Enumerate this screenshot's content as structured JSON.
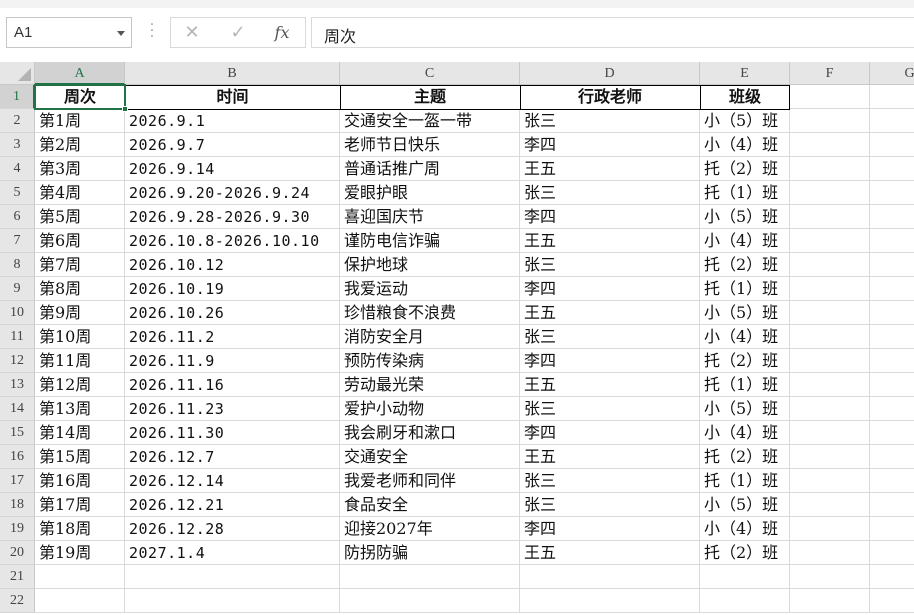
{
  "formula_bar": {
    "name_box": "A1",
    "cancel_icon": "✕",
    "enter_icon": "✓",
    "fx_label": "fx",
    "value": "周次"
  },
  "columns": [
    "A",
    "B",
    "C",
    "D",
    "E",
    "F",
    "G"
  ],
  "row_numbers": [
    "1",
    "2",
    "3",
    "4",
    "5",
    "6",
    "7",
    "8",
    "9",
    "10",
    "11",
    "12",
    "13",
    "14",
    "15",
    "16",
    "17",
    "18",
    "19",
    "20",
    "21",
    "22"
  ],
  "table": {
    "headers": [
      "周次",
      "时间",
      "主题",
      "行政老师",
      "班级"
    ],
    "rows": [
      [
        "第1周",
        "2026.9.1",
        "交通安全一盔一带",
        "张三",
        "小（5）班"
      ],
      [
        "第2周",
        "2026.9.7",
        "老师节日快乐",
        "李四",
        "小（4）班"
      ],
      [
        "第3周",
        "2026.9.14",
        "普通话推广周",
        "王五",
        "托（2）班"
      ],
      [
        "第4周",
        "2026.9.20-2026.9.24",
        "爱眼护眼",
        "张三",
        "托（1）班"
      ],
      [
        "第5周",
        "2026.9.28-2026.9.30",
        "喜迎国庆节",
        "李四",
        "小（5）班"
      ],
      [
        "第6周",
        "2026.10.8-2026.10.10",
        "谨防电信诈骗",
        "王五",
        "小（4）班"
      ],
      [
        "第7周",
        "2026.10.12",
        "保护地球",
        "张三",
        "托（2）班"
      ],
      [
        "第8周",
        "2026.10.19",
        "我爱运动",
        "李四",
        "托（1）班"
      ],
      [
        "第9周",
        "2026.10.26",
        "珍惜粮食不浪费",
        "王五",
        "小（5）班"
      ],
      [
        "第10周",
        "2026.11.2",
        "消防安全月",
        "张三",
        "小（4）班"
      ],
      [
        "第11周",
        "2026.11.9",
        "预防传染病",
        "李四",
        "托（2）班"
      ],
      [
        "第12周",
        "2026.11.16",
        "劳动最光荣",
        "王五",
        "托（1）班"
      ],
      [
        "第13周",
        "2026.11.23",
        "爱护小动物",
        "张三",
        "小（5）班"
      ],
      [
        "第14周",
        "2026.11.30",
        "我会刷牙和漱口",
        "李四",
        "小（4）班"
      ],
      [
        "第15周",
        "2026.12.7",
        "交通安全",
        "王五",
        "托（2）班"
      ],
      [
        "第16周",
        "2026.12.14",
        "我爱老师和同伴",
        "张三",
        "托（1）班"
      ],
      [
        "第17周",
        "2026.12.21",
        "食品安全",
        "张三",
        "小（5）班"
      ],
      [
        "第18周",
        "2026.12.28",
        "迎接2027年",
        "李四",
        "小（4）班"
      ],
      [
        "第19周",
        "2027.1.4",
        "防拐防骗",
        "王五",
        "托（2）班"
      ]
    ]
  },
  "colors": {
    "accent": "#217346",
    "header_bg": "#e6e6e6",
    "gridline": "#dadada"
  }
}
